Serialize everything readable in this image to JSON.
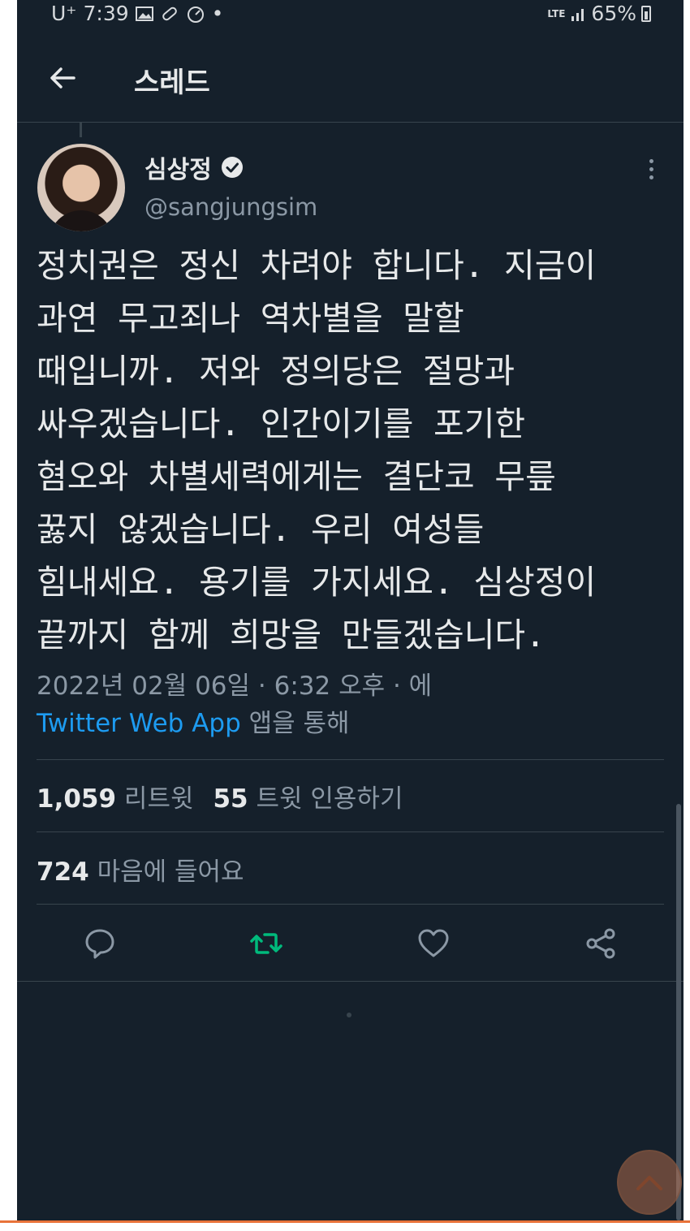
{
  "status_bar": {
    "carrier": "U⁺",
    "time": "7:39",
    "dot": "•",
    "network": "LTE",
    "battery": "65%"
  },
  "header": {
    "title": "스레드"
  },
  "tweet": {
    "author_name": "심상정",
    "handle": "@sangjungsim",
    "text": "정치권은 정신 차려야 합니다. 지금이\n과연 무고죄나 역차별을 말할\n때입니까. 저와 정의당은 절망과\n싸우겠습니다. 인간이기를 포기한\n혐오와 차별세력에게는 결단코 무릎\n꿇지 않겠습니다. 우리 여성들\n힘내세요. 용기를 가지세요. 심상정이\n끝까지 함께 희망을 만들겠습니다.",
    "timestamp": "2022년 02월 06일 · 6:32 오후 · 에",
    "source_app": "Twitter Web App",
    "source_suffix": " 앱을 통해"
  },
  "stats": {
    "retweets_count": "1,059",
    "retweets_label": "리트윗",
    "quotes_count": "55",
    "quotes_label": "트윗 인용하기",
    "likes_count": "724",
    "likes_label": "마음에 들어요"
  },
  "colors": {
    "background": "#15202b",
    "text": "#e7e9ea",
    "muted": "#8b98a5",
    "link": "#1d9bf0",
    "retweet_active": "#00ba7c"
  }
}
